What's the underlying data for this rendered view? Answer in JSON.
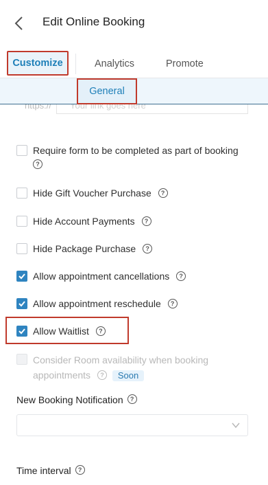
{
  "header": {
    "title": "Edit Online Booking",
    "back_icon": "chevron-left-icon"
  },
  "tabs": [
    {
      "label": "Customize",
      "active": true
    },
    {
      "label": "Analytics",
      "active": false
    },
    {
      "label": "Promote",
      "active": false
    }
  ],
  "subtabs": [
    {
      "label": "General",
      "active": true
    }
  ],
  "url_row": {
    "prefix": "https://",
    "placeholder": "Your link goes here"
  },
  "options": [
    {
      "label": "Require form to be completed as part of booking",
      "checked": false,
      "disabled": false,
      "help": "?"
    },
    {
      "label": "Hide Gift Voucher Purchase",
      "checked": false,
      "disabled": false,
      "help": "?"
    },
    {
      "label": "Hide Account Payments",
      "checked": false,
      "disabled": false,
      "help": "?"
    },
    {
      "label": "Hide Package Purchase",
      "checked": false,
      "disabled": false,
      "help": "?"
    },
    {
      "label": "Allow appointment cancellations",
      "checked": true,
      "disabled": false,
      "help": "?"
    },
    {
      "label": "Allow appointment reschedule",
      "checked": true,
      "disabled": false,
      "help": "?"
    },
    {
      "label": "Allow Waitlist",
      "checked": true,
      "disabled": false,
      "help": "?"
    },
    {
      "label": "Consider Room availability when booking appointments",
      "checked": false,
      "disabled": true,
      "help": "?",
      "badge": "Soon"
    }
  ],
  "new_booking_notification": {
    "label": "New Booking Notification",
    "help": "?",
    "value": ""
  },
  "time_interval": {
    "label": "Time interval",
    "help": "?"
  },
  "colors": {
    "accent": "#2f84c0",
    "highlight": "#c0392b",
    "subtab_bg": "#eef6fc"
  }
}
